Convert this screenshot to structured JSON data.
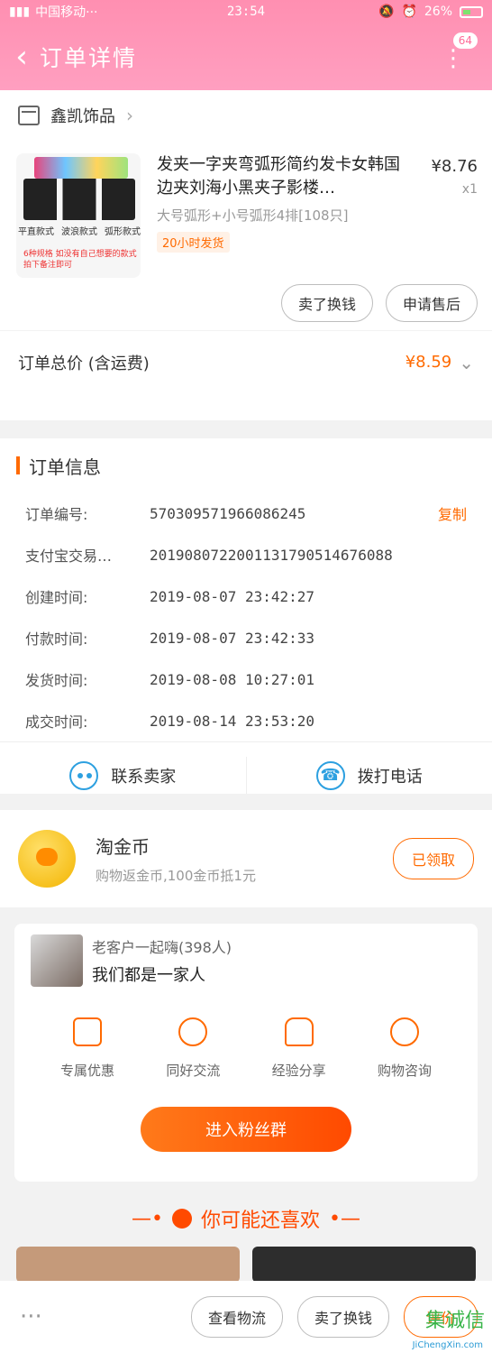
{
  "status": {
    "carrier": "中国移动···",
    "time": "23:54",
    "battery": "26%"
  },
  "header": {
    "title": "订单详情",
    "badge": "64"
  },
  "shop": {
    "name": "鑫凯饰品"
  },
  "item": {
    "name": "发夹一字夹弯弧形简约发卡女韩国边夹刘海小黑夹子影楼…",
    "spec": "大号弧形+小号弧形4排[108只]",
    "tag": "20小时发货",
    "price": "¥8.76",
    "qty": "x1",
    "thumb_labels": [
      "平直款式",
      "波浪款式",
      "弧形款式"
    ],
    "thumb_note": "6种规格 如没有自己想要的款式拍下备注即可"
  },
  "actions": {
    "exchange": "卖了换钱",
    "after_sale": "申请售后"
  },
  "total": {
    "label": "订单总价 (含运费)",
    "amount": "¥8.59"
  },
  "order_info": {
    "title": "订单信息",
    "rows": [
      {
        "label": "订单编号:",
        "value": "570309571966086245",
        "action": "复制"
      },
      {
        "label": "支付宝交易…",
        "value": "2019080722001131790514676088"
      },
      {
        "label": "创建时间:",
        "value": "2019-08-07 23:42:27"
      },
      {
        "label": "付款时间:",
        "value": "2019-08-07 23:42:33"
      },
      {
        "label": "发货时间:",
        "value": "2019-08-08 10:27:01"
      },
      {
        "label": "成交时间:",
        "value": "2019-08-14 23:53:20"
      }
    ]
  },
  "contact": {
    "seller": "联系卖家",
    "call": "拨打电话"
  },
  "coin": {
    "title": "淘金币",
    "sub": "购物返金币,100金币抵1元",
    "button": "已领取"
  },
  "fans": {
    "count": "老客户一起嗨(398人)",
    "motto": "我们都是一家人",
    "perks": [
      "专属优惠",
      "同好交流",
      "经验分享",
      "购物咨询"
    ],
    "join": "进入粉丝群"
  },
  "recommend": {
    "title": "你可能还喜欢"
  },
  "bottom": {
    "logistics": "查看物流",
    "exchange": "卖了换钱",
    "review": "评价"
  },
  "watermark": {
    "text": "集诚信",
    "sub": "JiChengXin.com"
  }
}
